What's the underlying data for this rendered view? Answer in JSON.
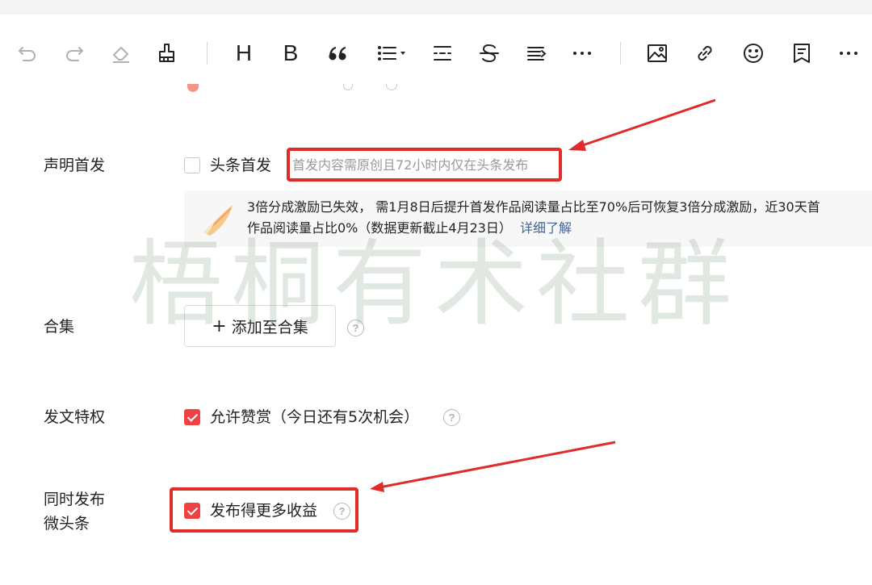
{
  "toolbar": {
    "items": [
      {
        "icon": "undo-icon",
        "disabled": true
      },
      {
        "icon": "redo-icon",
        "disabled": true
      },
      {
        "icon": "eraser-icon",
        "disabled": true
      },
      {
        "icon": "format-painter-icon",
        "disabled": false
      },
      {
        "icon": "heading-icon",
        "glyph": "H"
      },
      {
        "icon": "bold-icon",
        "glyph": "B"
      },
      {
        "icon": "quote-icon"
      },
      {
        "icon": "list-icon"
      },
      {
        "icon": "divider-icon"
      },
      {
        "icon": "strikethrough-icon"
      },
      {
        "icon": "indent-icon"
      },
      {
        "icon": "more-format-icon"
      },
      {
        "icon": "image-icon"
      },
      {
        "icon": "link-icon"
      },
      {
        "icon": "emoji-icon"
      },
      {
        "icon": "document-icon"
      },
      {
        "icon": "more-insert-icon"
      }
    ],
    "heading_glyph": "H",
    "bold_glyph": "B"
  },
  "first_publish": {
    "label": "声明首发",
    "option_label": "头条首发",
    "checked": false,
    "hint": "首发内容需原创且72小时内仅在头条发布",
    "notice_text": "3倍分成激励已失效， 需1月8日后提升首发作品阅读量占比至70%后可恢复3倍分成激励，近30天首",
    "notice_text_2": "作品阅读量占比0%（数据更新截止4月23日）",
    "notice_link": "详细了解"
  },
  "collection": {
    "label": "合集",
    "button_icon": "+",
    "button_label": "添加至合集"
  },
  "privilege": {
    "label": "发文特权",
    "option_label": "允许赞赏（今日还有5次机会）",
    "checked": true
  },
  "micro_headline": {
    "label_line1": "同时发布",
    "label_line2": "微头条",
    "option_label": "发布得更多收益",
    "checked": true
  },
  "watermark": "梧桐有术社群",
  "colors": {
    "accent_red": "#f04142",
    "annotation_red": "#e02b2b",
    "link_blue": "#406599",
    "hint_gray": "#999999"
  }
}
